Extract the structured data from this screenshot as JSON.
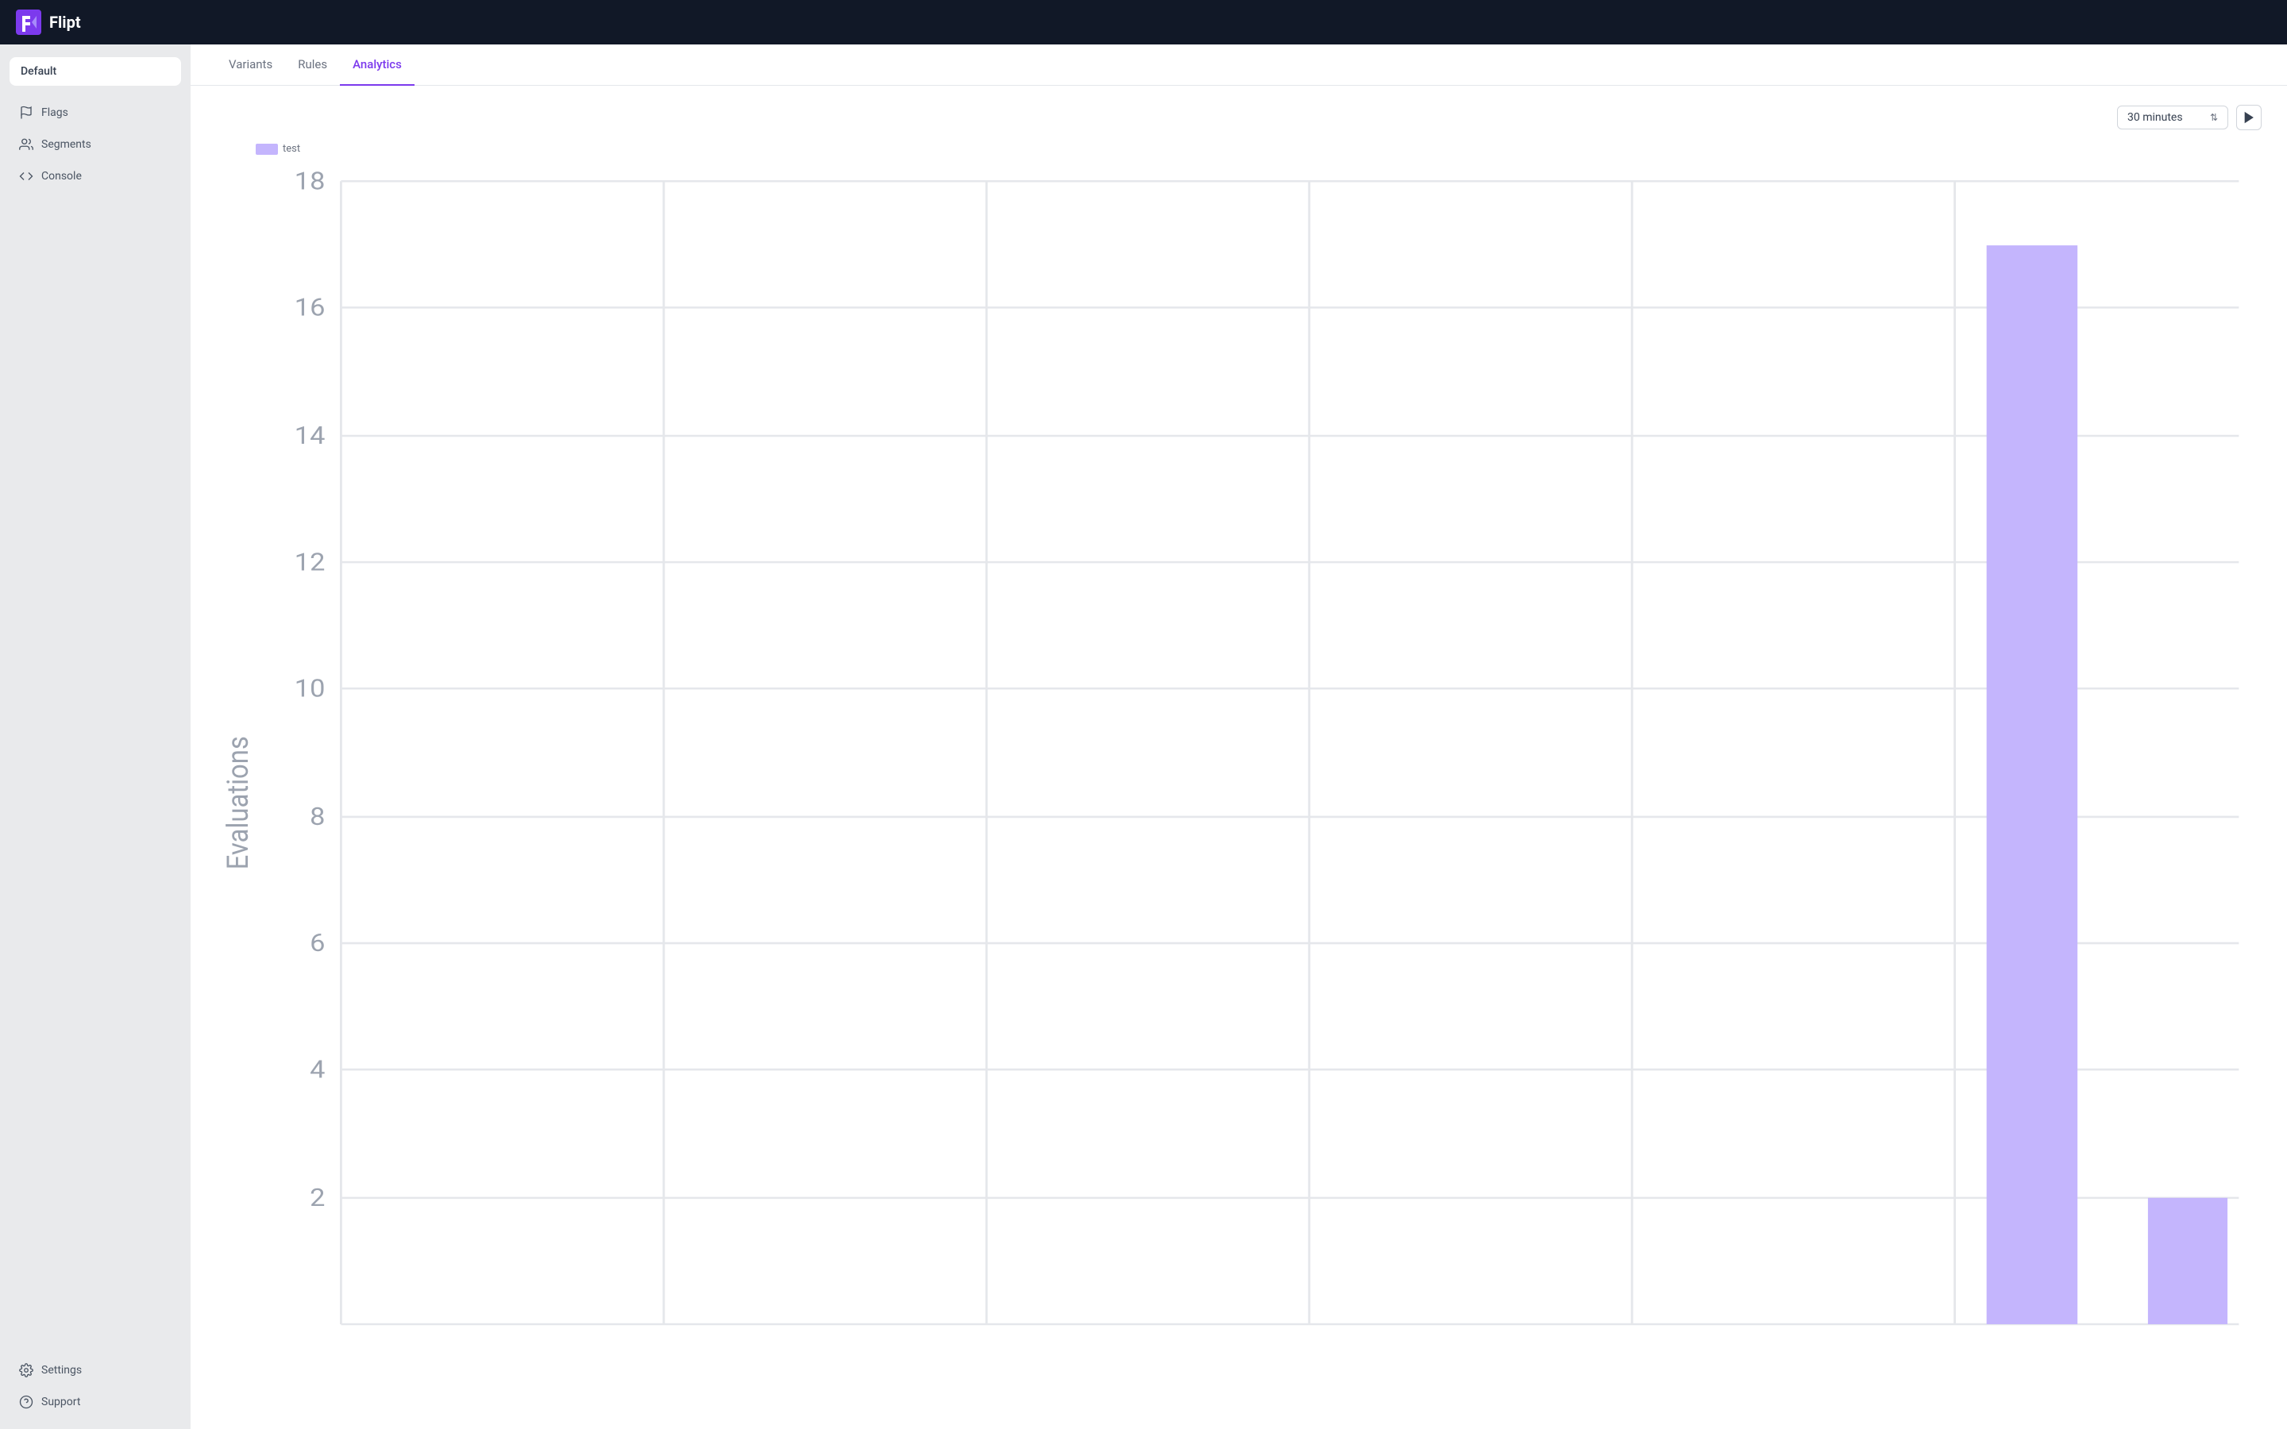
{
  "topbar": {
    "logo_text": "Flipt"
  },
  "sidebar": {
    "namespace": "Default",
    "nav_items": [
      {
        "id": "flags",
        "label": "Flags",
        "icon": "flag"
      },
      {
        "id": "segments",
        "label": "Segments",
        "icon": "users"
      },
      {
        "id": "console",
        "label": "Console",
        "icon": "code"
      }
    ],
    "bottom_items": [
      {
        "id": "settings",
        "label": "Settings",
        "icon": "gear"
      },
      {
        "id": "support",
        "label": "Support",
        "icon": "circle-question"
      }
    ]
  },
  "tabs": [
    {
      "id": "variants",
      "label": "Variants"
    },
    {
      "id": "rules",
      "label": "Rules"
    },
    {
      "id": "analytics",
      "label": "Analytics"
    }
  ],
  "active_tab": "analytics",
  "chart": {
    "time_select_label": "30 minutes",
    "legend_label": "test",
    "y_axis_label": "Evaluations",
    "y_max": 18,
    "y_ticks": [
      2,
      4,
      6,
      8,
      10,
      12,
      14,
      16,
      18
    ],
    "bar_color": "#c4b5fd",
    "bar_data": [
      0,
      0,
      0,
      0,
      17,
      2
    ],
    "run_button_label": "Run"
  }
}
